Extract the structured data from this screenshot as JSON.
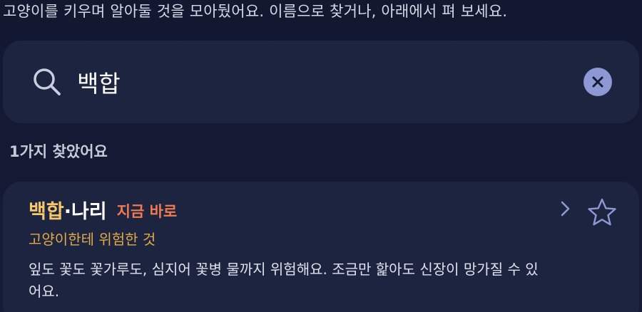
{
  "intro": {
    "text": "고양이를 키우며 알아둘 것을 모아뒀어요. 이름으로 찾거나, 아래에서 펴 보세요."
  },
  "search": {
    "value": "백합",
    "icon": "search-icon",
    "clear_icon": "close-icon"
  },
  "results": {
    "count_text": "1가지 찾았어요",
    "items": [
      {
        "title_match": "백합",
        "title_rest": "·나리",
        "badge": "지금 바로",
        "subtitle": "고양이한테 위험한 것",
        "body": "잎도 꽃도 꽃가루도, 심지어 꽃병 물까지 위험해요. 조금만 핥아도 신장이 망가질 수 있어요."
      }
    ]
  },
  "colors": {
    "background": "#141a33",
    "surface": "#1d2440",
    "highlight": "#f5c76a",
    "badge": "#f07a52",
    "subtitle": "#e0a948",
    "clear_button": "#8d98d4",
    "icon": "#8d98d4"
  }
}
